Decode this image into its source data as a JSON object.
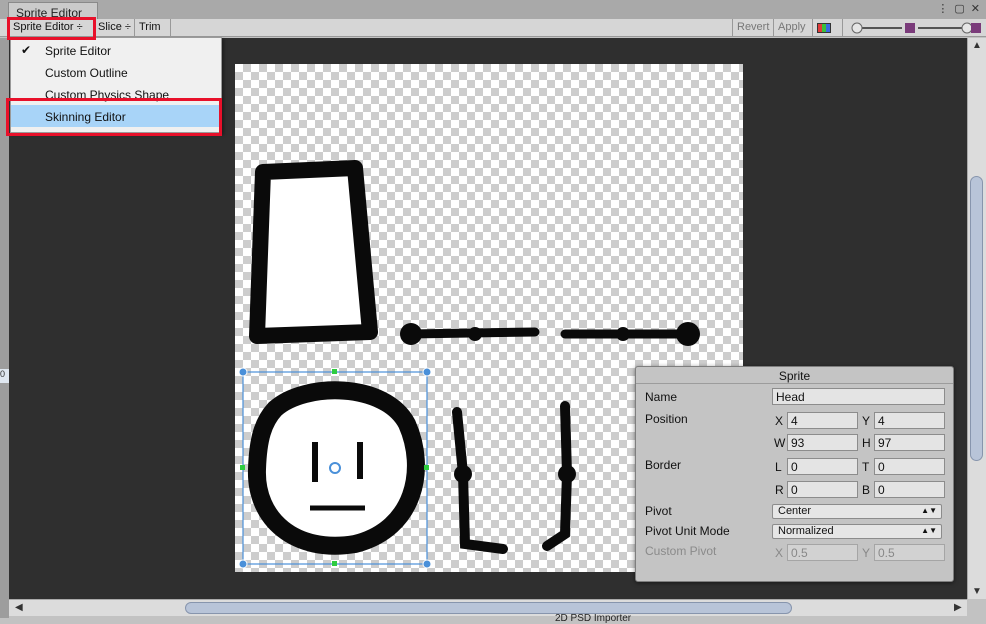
{
  "window": {
    "title": "Sprite Editor"
  },
  "toolbar": {
    "mode": "Sprite Editor ÷",
    "slice": "Slice ÷",
    "trim": "Trim",
    "revert": "Revert",
    "apply": "Apply"
  },
  "menu": {
    "items": [
      {
        "label": "Sprite Editor",
        "checked": true
      },
      {
        "label": "Custom Outline"
      },
      {
        "label": "Custom Physics Shape"
      },
      {
        "label": "Skinning Editor",
        "selected": true
      }
    ]
  },
  "left_tag": "0",
  "bottom_peek": "2D PSD Importer",
  "sprite_panel": {
    "title": "Sprite",
    "name_label": "Name",
    "name_value": "Head",
    "position_label": "Position",
    "x_label": "X",
    "x": "4",
    "y_label": "Y",
    "y": "4",
    "w_label": "W",
    "w": "93",
    "h_label": "H",
    "h": "97",
    "border_label": "Border",
    "l_label": "L",
    "l": "0",
    "t_label": "T",
    "t": "0",
    "r_label": "R",
    "r": "0",
    "b_label": "B",
    "b": "0",
    "pivot_label": "Pivot",
    "pivot_value": "Center",
    "pivot_unit_label": "Pivot Unit Mode",
    "pivot_unit_value": "Normalized",
    "custom_pivot_label": "Custom Pivot",
    "cx_label": "X",
    "cx": "0.5",
    "cy_label": "Y",
    "cy": "0.5"
  },
  "colors": {
    "highlight": "#e8102a",
    "selection": "#a8d4f8",
    "canvas": "#2f2f2f",
    "sprite_rect": "#4a90d9",
    "handle": "#2ecc40"
  }
}
